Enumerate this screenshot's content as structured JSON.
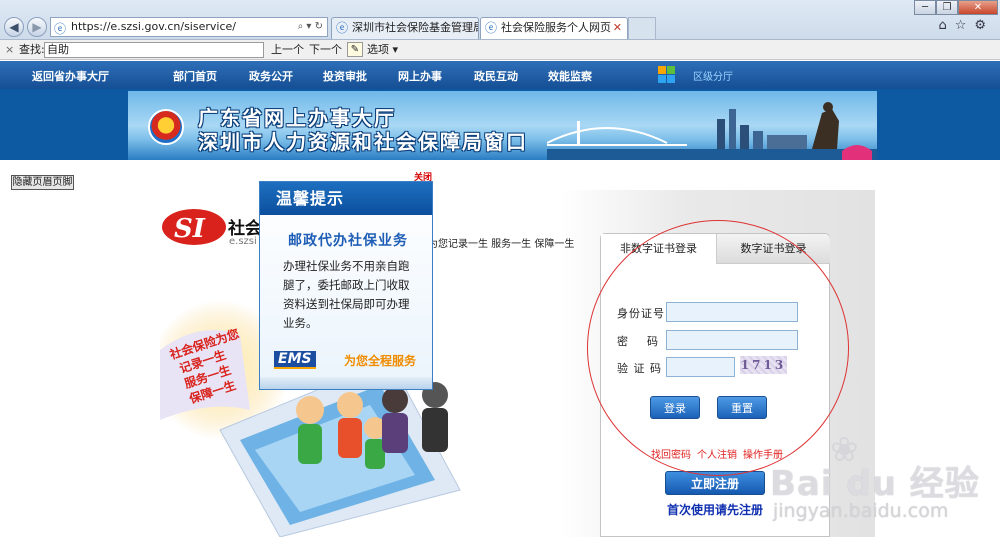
{
  "browser": {
    "address": "https://e.szsi.gov.cn/siservice/",
    "address_tools": "⌕ ▾ ↻",
    "tabs": [
      {
        "label": "深圳市社会保险基金管理局"
      },
      {
        "label": "社会保险服务个人网页"
      }
    ],
    "window_buttons": [
      "─",
      "❐",
      "✕"
    ],
    "right_icons": "⌂☆⚙"
  },
  "findbar": {
    "close": "×",
    "label": "查找:",
    "value": "自助",
    "prev": "上一个",
    "next": "下一个",
    "options": "选项 ▾"
  },
  "sitenav": {
    "items": [
      "返回省办事大厅",
      "部门首页",
      "政务公开",
      "投资审批",
      "网上办事",
      "政民互动",
      "效能监察"
    ],
    "sub": "区级分厅"
  },
  "banner": {
    "line1": "广东省网上办事大厅",
    "line2": "深圳市人力资源和社会保障局窗口"
  },
  "page": {
    "hide_header_footer": "隐藏页眉页脚",
    "brand_name": "社会",
    "brand_domain": "e.szsi",
    "slogan": "为您记录一生  服务一生  保障一生",
    "illus_text": [
      "社会保险为您",
      "记录一生",
      "服务一生",
      "保障一生"
    ]
  },
  "popup": {
    "close": "关闭",
    "title": "温馨提示",
    "subtitle": "邮政代办社保业务",
    "body": "办理社保业务不用亲自跑腿了，委托邮政上门收取资料送到社保局即可办理业务。",
    "ems_logo": "EMS",
    "ems_text": "为您全程服务"
  },
  "login": {
    "tab_active": "非数字证书登录",
    "tab_other": "数字证书登录",
    "id_label": "身份证号",
    "pwd_label": "密    码",
    "captcha_label": "验 证 码",
    "captcha_value": "1713",
    "login_btn": "登录",
    "reset_btn": "重置",
    "links": [
      "找回密码",
      "个人注销",
      "操作手册"
    ],
    "register_btn": "立即注册",
    "register_hint": "首次使用请先注册"
  },
  "watermark": {
    "text": "Bai du 经验",
    "url": "jingyan.baidu.com"
  },
  "colors": {
    "nav_blue": "#1d5ca6",
    "popup_blue": "#1e6fc0",
    "ems_orange": "#f08c00",
    "highlight_red": "#d33333"
  }
}
